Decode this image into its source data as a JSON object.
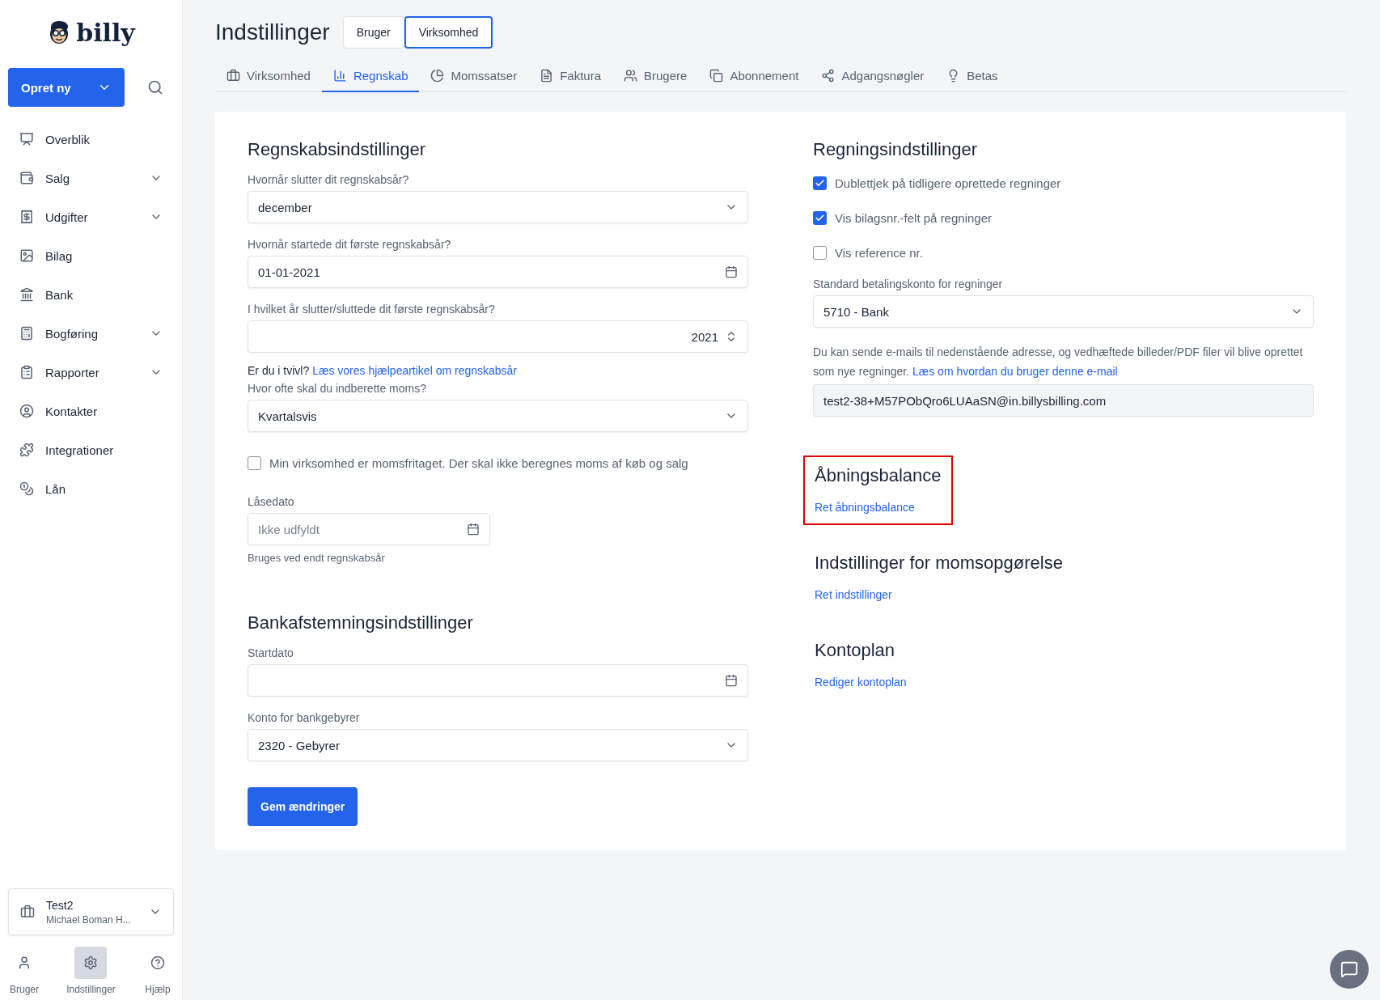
{
  "sidebar": {
    "logo": "billy",
    "create_button": "Opret ny",
    "nav": [
      {
        "label": "Overblik",
        "expandable": false
      },
      {
        "label": "Salg",
        "expandable": true
      },
      {
        "label": "Udgifter",
        "expandable": true
      },
      {
        "label": "Bilag",
        "expandable": false
      },
      {
        "label": "Bank",
        "expandable": false
      },
      {
        "label": "Bogføring",
        "expandable": true
      },
      {
        "label": "Rapporter",
        "expandable": true
      },
      {
        "label": "Kontakter",
        "expandable": false
      },
      {
        "label": "Integrationer",
        "expandable": false
      },
      {
        "label": "Lån",
        "expandable": false
      }
    ],
    "company": {
      "name": "Test2",
      "owner": "Michael Boman H..."
    },
    "bottom_nav": [
      {
        "label": "Bruger",
        "selected": false
      },
      {
        "label": "Indstillinger",
        "selected": true
      },
      {
        "label": "Hjælp",
        "selected": false
      }
    ]
  },
  "header": {
    "title": "Indstillinger",
    "scope": [
      {
        "label": "Bruger",
        "selected": false
      },
      {
        "label": "Virksomhed",
        "selected": true
      }
    ]
  },
  "tabs": [
    {
      "label": "Virksomhed",
      "selected": false
    },
    {
      "label": "Regnskab",
      "selected": true
    },
    {
      "label": "Momssatser",
      "selected": false
    },
    {
      "label": "Faktura",
      "selected": false
    },
    {
      "label": "Brugere",
      "selected": false
    },
    {
      "label": "Abonnement",
      "selected": false
    },
    {
      "label": "Adgangsnøgler",
      "selected": false
    },
    {
      "label": "Betas",
      "selected": false
    }
  ],
  "left": [
    {
      "title": "Regnskabsindstillinger",
      "items": [
        {
          "kind": "select",
          "label": "Hvornår slutter dit regnskabsår?",
          "value": "december"
        },
        {
          "kind": "date",
          "label": "Hvornår startede dit første regnskabsår?",
          "value": "01-01-2021"
        },
        {
          "kind": "number",
          "label": "I hvilket år slutter/sluttede dit første regnskabsår?",
          "value": "2021"
        },
        {
          "kind": "help",
          "text": "Er du i tvivl?",
          "link": "Læs vores hjælpeartikel om regnskabsår"
        },
        {
          "kind": "select",
          "label": "Hvor ofte skal du indberette moms?",
          "value": "Kvartalsvis"
        },
        {
          "kind": "checkbox",
          "label": "Min virksomhed er momsfritaget. Der skal ikke beregnes moms af køb og salg",
          "checked": false
        },
        {
          "kind": "shortdate",
          "label": "Låsedato",
          "placeholder": "Ikke udfyldt",
          "hint": "Bruges ved endt regnskabsår"
        }
      ]
    },
    {
      "title": "Bankafstemningsindstillinger",
      "items": [
        {
          "kind": "date",
          "label": "Startdato",
          "value": ""
        },
        {
          "kind": "select",
          "label": "Konto for bankgebyrer",
          "value": "2320 - Gebyrer"
        }
      ]
    }
  ],
  "save_button": "Gem ændringer",
  "right": {
    "title": "Regningsindstillinger",
    "checkboxes": [
      {
        "label": "Dublettjek på tidligere oprettede regninger",
        "checked": true
      },
      {
        "label": "Vis bilagsnr.-felt på regninger",
        "checked": true
      },
      {
        "label": "Vis reference nr.",
        "checked": false
      }
    ],
    "account_label": "Standard betalingskonto for regninger",
    "account_value": "5710 - Bank",
    "email_note": "Du kan sende e-mails til nedenstående adresse, og vedhæftede billeder/PDF filer vil blive oprettet som nye regninger.",
    "email_link": "Læs om hvordan du bruger denne e-mail",
    "email": "test2-38+M57PObQro6LUAaSN@in.billysbilling.com",
    "sections": [
      {
        "title": "Åbningsbalance",
        "link": "Ret åbningsbalance",
        "highlighted": true
      },
      {
        "title": "Indstillinger for momsopgørelse",
        "link": "Ret indstillinger",
        "highlighted": false
      },
      {
        "title": "Kontoplan",
        "link": "Rediger kontoplan",
        "highlighted": false
      }
    ]
  }
}
